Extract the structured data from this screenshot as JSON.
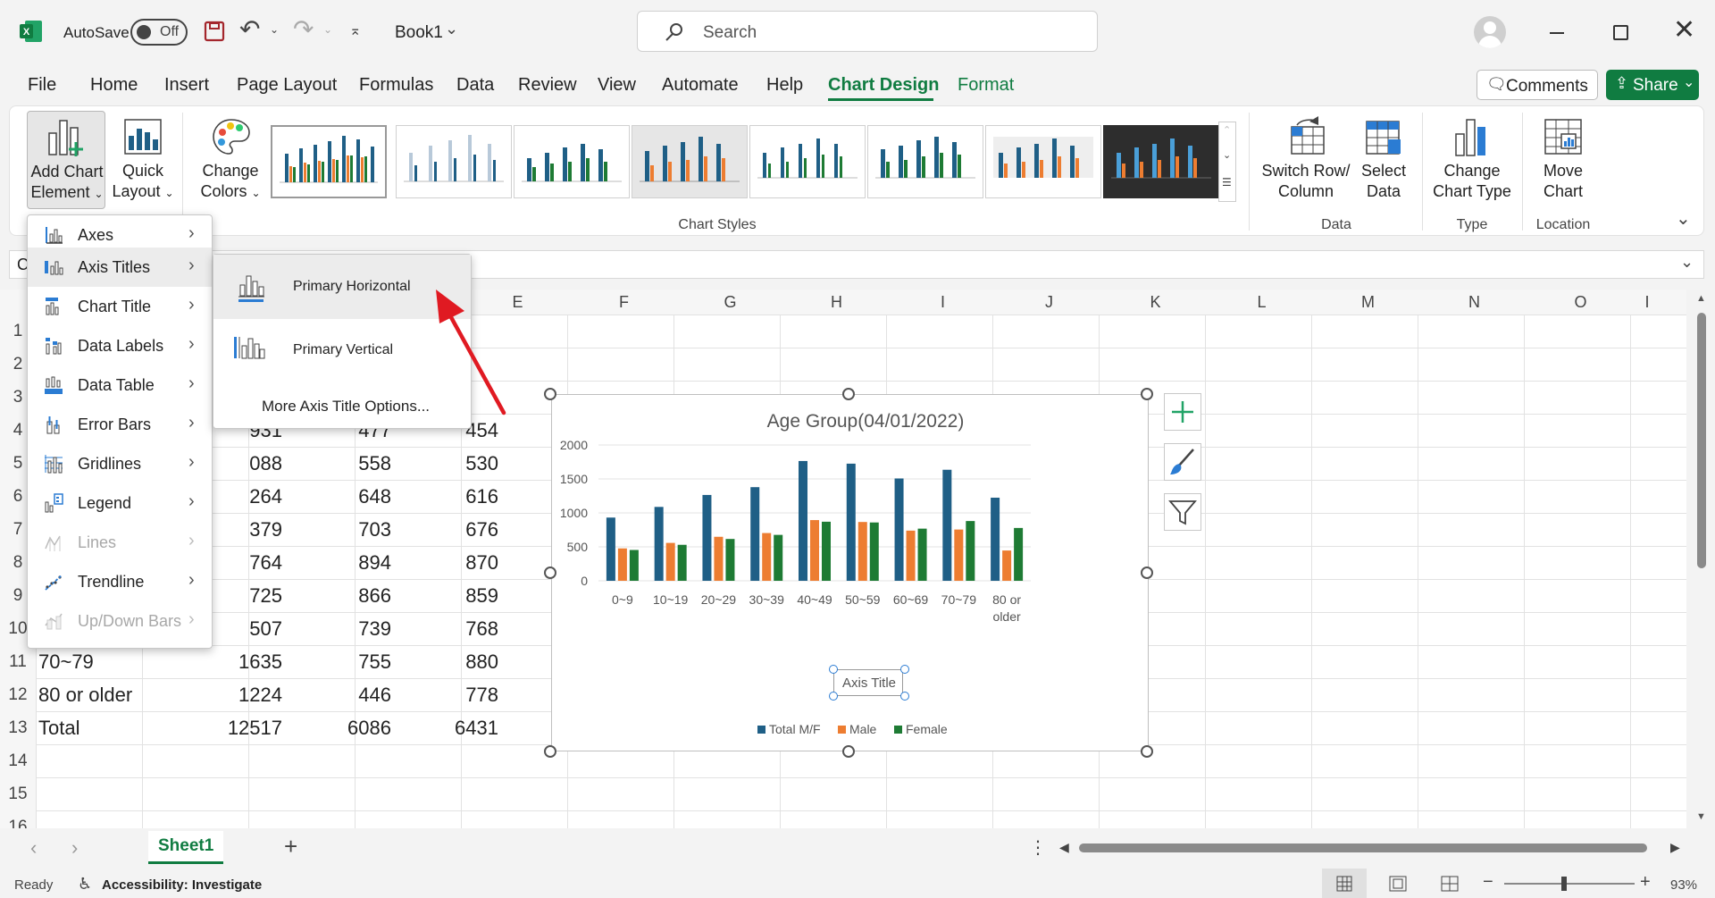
{
  "titlebar": {
    "autosave_label": "AutoSave",
    "autosave_state": "Off",
    "filename": "Book1",
    "search_placeholder": "Search"
  },
  "tabs": [
    "File",
    "Home",
    "Insert",
    "Page Layout",
    "Formulas",
    "Data",
    "Review",
    "View",
    "Automate",
    "Help",
    "Chart Design",
    "Format"
  ],
  "active_tab": "Chart Design",
  "buttons": {
    "comments": "Comments",
    "share": "Share"
  },
  "ribbon": {
    "add_chart_element": [
      "Add Chart",
      "Element"
    ],
    "quick_layout": [
      "Quick",
      "Layout"
    ],
    "change_colors": [
      "Change",
      "Colors"
    ],
    "chart_styles_label": "Chart Styles",
    "switch_row_column": [
      "Switch Row/",
      "Column"
    ],
    "select_data": [
      "Select",
      "Data"
    ],
    "data_group": "Data",
    "change_chart_type": [
      "Change",
      "Chart Type"
    ],
    "type_group": "Type",
    "move_chart": [
      "Move",
      "Chart"
    ],
    "location_group": "Location"
  },
  "formula_bar": {
    "name_box": "C"
  },
  "columns": [
    "E",
    "F",
    "G",
    "H",
    "I",
    "J",
    "K",
    "L",
    "M",
    "N",
    "O",
    "I"
  ],
  "rows": [
    "1",
    "2",
    "3",
    "4",
    "5",
    "6",
    "7",
    "8",
    "9",
    "10",
    "11",
    "12",
    "13",
    "14",
    "15",
    "16"
  ],
  "table": [
    {
      "label": "",
      "total": "931",
      "male": "477",
      "female": "454"
    },
    {
      "label": "",
      "total": "088",
      "male": "558",
      "female": "530"
    },
    {
      "label": "",
      "total": "264",
      "male": "648",
      "female": "616"
    },
    {
      "label": "",
      "total": "379",
      "male": "703",
      "female": "676"
    },
    {
      "label": "",
      "total": "764",
      "male": "894",
      "female": "870"
    },
    {
      "label": "",
      "total": "725",
      "male": "866",
      "female": "859"
    },
    {
      "label": "",
      "total": "507",
      "male": "739",
      "female": "768"
    },
    {
      "label": "70~79",
      "total": "1635",
      "male": "755",
      "female": "880"
    },
    {
      "label": "80 or older",
      "total": "1224",
      "male": "446",
      "female": "778"
    },
    {
      "label": "Total",
      "total": "12517",
      "male": "6086",
      "female": "6431"
    }
  ],
  "menu": {
    "items": [
      {
        "label": "Axes",
        "disabled": false
      },
      {
        "label": "Axis Titles",
        "disabled": false
      },
      {
        "label": "Chart Title",
        "disabled": false
      },
      {
        "label": "Data Labels",
        "disabled": false
      },
      {
        "label": "Data Table",
        "disabled": false
      },
      {
        "label": "Error Bars",
        "disabled": false
      },
      {
        "label": "Gridlines",
        "disabled": false
      },
      {
        "label": "Legend",
        "disabled": false
      },
      {
        "label": "Lines",
        "disabled": true
      },
      {
        "label": "Trendline",
        "disabled": false
      },
      {
        "label": "Up/Down Bars",
        "disabled": true
      }
    ],
    "submenu": {
      "primary_horizontal": "Primary Horizontal",
      "primary_vertical": "Primary Vertical",
      "more_options": "More Axis Title Options..."
    }
  },
  "colors": {
    "accent": "#107c41",
    "total": "#1f5f86",
    "male": "#ed7d31",
    "female": "#1e7b34",
    "arrow": "#e01a22"
  },
  "chart_data": {
    "type": "bar",
    "title": "Age Group(04/01/2022)",
    "xlabel": "Axis Title",
    "ylabel": "",
    "categories": [
      "0~9",
      "10~19",
      "20~29",
      "30~39",
      "40~49",
      "50~59",
      "60~69",
      "70~79",
      "80 or older"
    ],
    "series": [
      {
        "name": "Total M/F",
        "values": [
          931,
          1088,
          1264,
          1379,
          1764,
          1725,
          1507,
          1635,
          1224
        ]
      },
      {
        "name": "Male",
        "values": [
          477,
          558,
          648,
          703,
          894,
          866,
          739,
          755,
          446
        ]
      },
      {
        "name": "Female",
        "values": [
          454,
          530,
          616,
          676,
          870,
          859,
          768,
          880,
          778
        ]
      }
    ],
    "ylim": [
      0,
      2000
    ],
    "yticks": [
      "0",
      "500",
      "1000",
      "1500",
      "2000"
    ],
    "grid": true,
    "legend_position": "bottom"
  },
  "sheet": {
    "tab": "Sheet1"
  },
  "status": {
    "ready": "Ready",
    "accessibility": "Accessibility: Investigate",
    "zoom": "93%"
  }
}
